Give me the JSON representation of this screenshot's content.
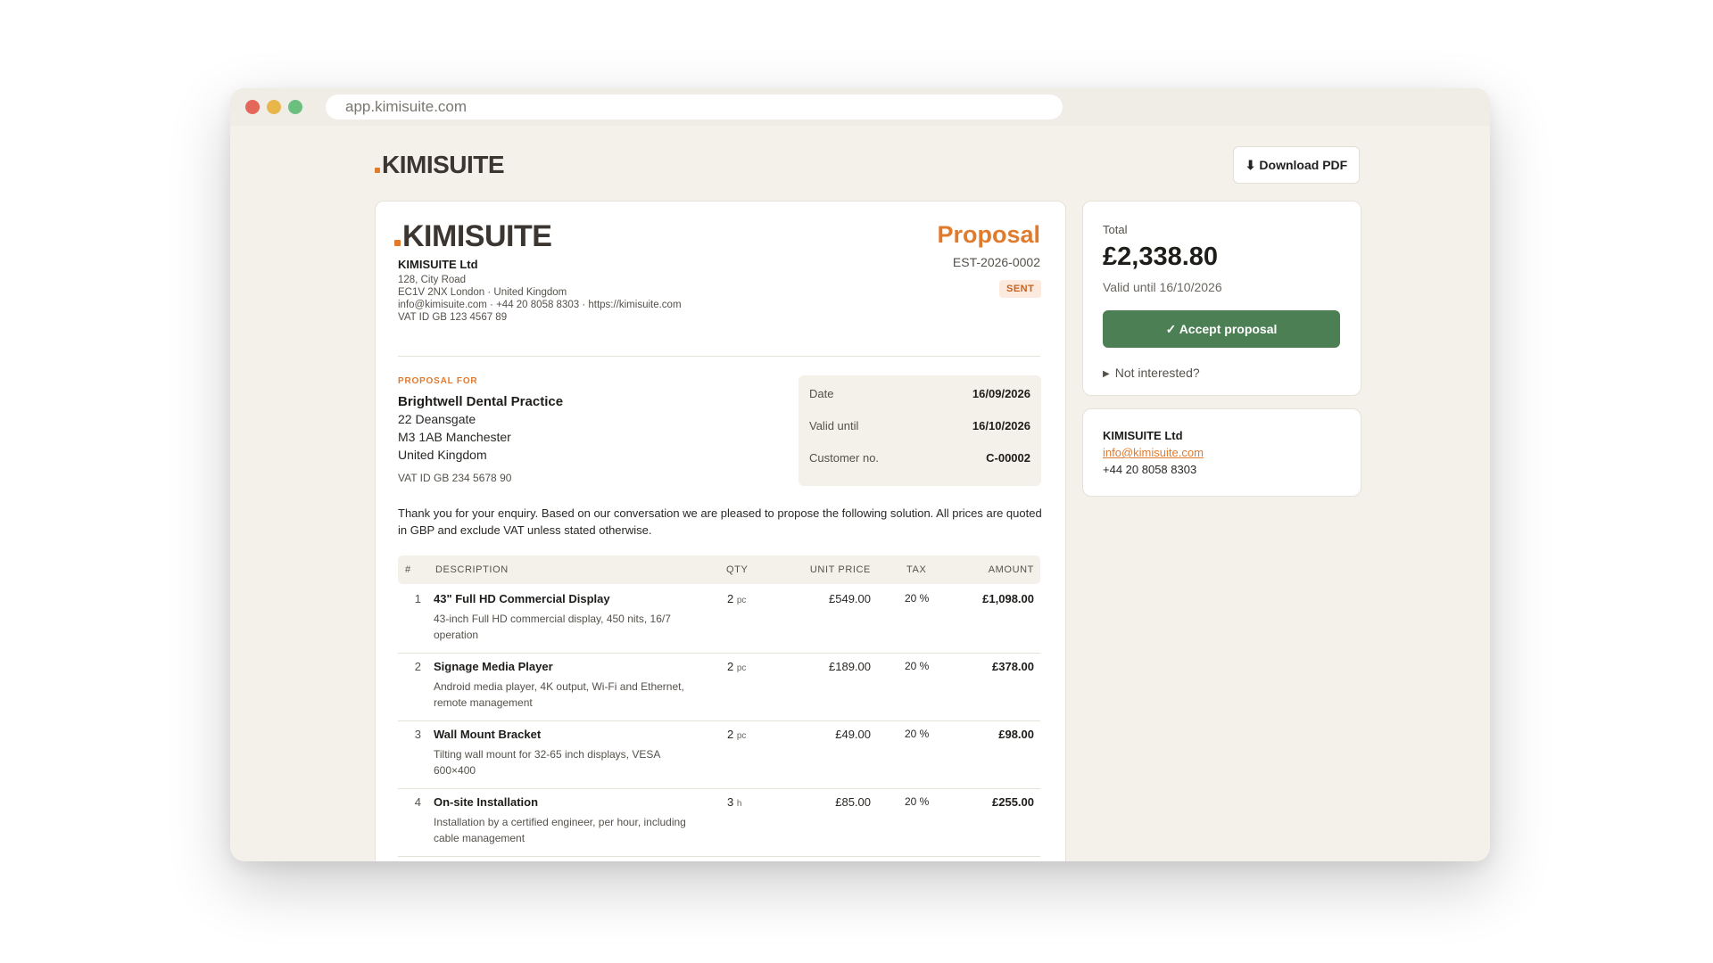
{
  "browser": {
    "url": "app.kimisuite.com"
  },
  "brand": {
    "logo_text": "KIMISUITE",
    "accent": "#e07b2e"
  },
  "toolbar": {
    "download_label": "⬇ Download PDF"
  },
  "document": {
    "title": "Proposal",
    "number": "EST-2026-0002",
    "status": "SENT",
    "company": {
      "name": "KIMISUITE Ltd",
      "address1": "128, City Road",
      "address2": "EC1V 2NX London · United Kingdom",
      "contact": "info@kimisuite.com · +44 20 8058 8303 · https://kimisuite.com",
      "vat": "VAT ID GB 123 4567 89"
    },
    "client": {
      "section_label": "PROPOSAL FOR",
      "name": "Brightwell Dental Practice",
      "address1": "22 Deansgate",
      "address2": "M3 1AB Manchester",
      "country": "United Kingdom",
      "vat": "VAT ID GB 234 5678 90"
    },
    "meta": [
      {
        "label": "Date",
        "value": "16/09/2026"
      },
      {
        "label": "Valid until",
        "value": "16/10/2026"
      },
      {
        "label": "Customer no.",
        "value": "C-00002"
      }
    ],
    "intro": "Thank you for your enquiry. Based on our conversation we are pleased to propose the following solution. All prices are quoted in GBP and exclude VAT unless stated otherwise.",
    "table": {
      "headers": {
        "num": "#",
        "description": "DESCRIPTION",
        "qty": "QTY",
        "unit_price": "UNIT PRICE",
        "tax": "TAX",
        "amount": "AMOUNT"
      },
      "rows": [
        {
          "num": "1",
          "title": "43\" Full HD Commercial Display",
          "desc": "43-inch Full HD commercial display, 450 nits, 16/7 operation",
          "qty": "2",
          "unit": "pc",
          "price": "£549.00",
          "tax": "20 %",
          "amount": "£1,098.00"
        },
        {
          "num": "2",
          "title": "Signage Media Player",
          "desc": "Android media player, 4K output, Wi-Fi and Ethernet, remote management",
          "qty": "2",
          "unit": "pc",
          "price": "£189.00",
          "tax": "20 %",
          "amount": "£378.00"
        },
        {
          "num": "3",
          "title": "Wall Mount Bracket",
          "desc": "Tilting wall mount for 32-65 inch displays, VESA 600×400",
          "qty": "2",
          "unit": "pc",
          "price": "£49.00",
          "tax": "20 %",
          "amount": "£98.00"
        },
        {
          "num": "4",
          "title": "On-site Installation",
          "desc": "Installation by a certified engineer, per hour, including cable management",
          "qty": "3",
          "unit": "h",
          "price": "£85.00",
          "tax": "20 %",
          "amount": "£255.00"
        }
      ]
    }
  },
  "summary": {
    "total_label": "Total",
    "total_amount": "£2,338.80",
    "valid_text": "Valid until 16/10/2026",
    "accept_label": "✓ Accept proposal",
    "accept_color": "#4d7f55",
    "not_interested_label": "Not interested?"
  },
  "contact": {
    "name": "KIMISUITE Ltd",
    "email": "info@kimisuite.com",
    "phone": "+44 20 8058 8303"
  }
}
